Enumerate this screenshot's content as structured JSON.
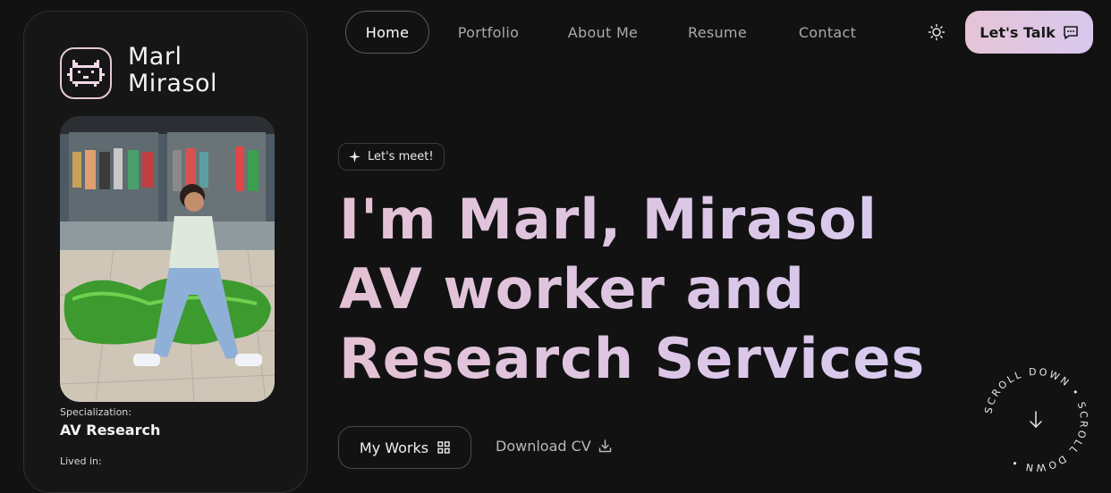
{
  "profile": {
    "first_name": "Marl",
    "last_name": "Mirasol",
    "logo_icon": "pixel-cat-icon",
    "specialization_label": "Specialization:",
    "specialization_value": "AV Research",
    "lived_in_label": "Lived in:"
  },
  "nav": {
    "items": [
      {
        "label": "Home",
        "active": true
      },
      {
        "label": "Portfolio"
      },
      {
        "label": "About Me"
      },
      {
        "label": "Resume"
      },
      {
        "label": "Contact"
      }
    ],
    "theme_icon": "sun-icon",
    "cta_label": "Let's Talk",
    "cta_icon": "chat-icon"
  },
  "hero": {
    "badge": "Let's meet!",
    "badge_icon": "sparkle-icon",
    "lines": [
      "I'm Marl, Mirasol",
      "AV worker and",
      "Research Services"
    ],
    "primary_button": "My Works",
    "primary_icon": "grid-icon",
    "secondary_button": "Download CV",
    "secondary_icon": "download-icon"
  },
  "scroll": {
    "text": "SCROLL DOWN • SCROLL DOWN •",
    "icon": "arrow-down-icon"
  },
  "colors": {
    "background": "#121213",
    "accent_pink": "#e4c2d3",
    "accent_lavender": "#d7cbef"
  }
}
